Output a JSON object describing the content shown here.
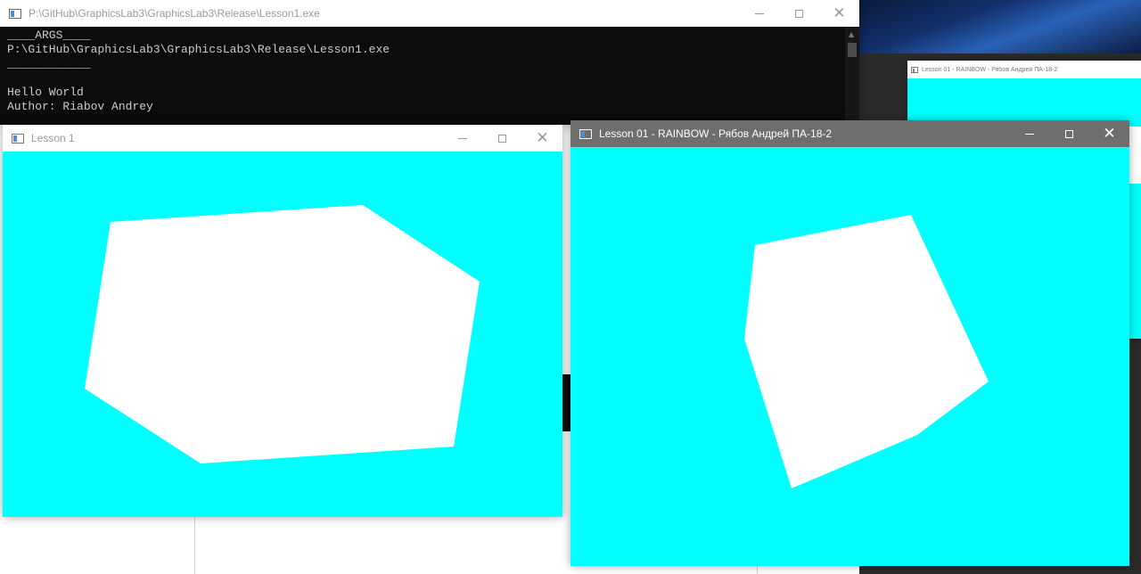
{
  "colors": {
    "canvas_bg": "#00FFFF",
    "polygon_fill": "#FFFFFF",
    "console_bg": "#0C0C0C",
    "console_text": "#CCCCCC",
    "active_titlebar": "#6E6E6E"
  },
  "console": {
    "title": "P:\\GitHub\\GraphicsLab3\\GraphicsLab3\\Release\\Lesson1.exe",
    "lines": [
      "____ARGS____",
      "P:\\GitHub\\GraphicsLab3\\GraphicsLab3\\Release\\Lesson1.exe",
      "____________",
      "",
      "Hello World",
      "Author: Riabov Andrey"
    ],
    "icon": "console-app-icon"
  },
  "window_lesson1": {
    "title": "Lesson 1",
    "icon": "app-window-icon"
  },
  "window_rainbow": {
    "title": "Lesson 01 - RAINBOW - Рябов Андрей ПА-18-2",
    "icon": "app-window-icon"
  },
  "window_background": {
    "title": "Lesson 01 - RAINBOW - Рябов Андрей ПА-18-2"
  },
  "controls": {
    "minimize": "minimize",
    "maximize": "maximize",
    "close": "✕"
  }
}
